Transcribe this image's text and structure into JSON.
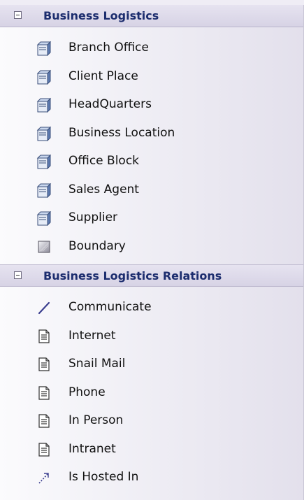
{
  "toolbox": {
    "groups": [
      {
        "title": "Business Logistics",
        "items": [
          {
            "label": "Branch Office",
            "icon": "node-icon"
          },
          {
            "label": "Client Place",
            "icon": "node-icon"
          },
          {
            "label": "HeadQuarters",
            "icon": "node-icon"
          },
          {
            "label": "Business Location",
            "icon": "node-icon"
          },
          {
            "label": "Office Block",
            "icon": "node-icon"
          },
          {
            "label": "Sales Agent",
            "icon": "node-icon"
          },
          {
            "label": "Supplier",
            "icon": "node-icon"
          },
          {
            "label": "Boundary",
            "icon": "boundary-icon"
          }
        ]
      },
      {
        "title": "Business Logistics Relations",
        "items": [
          {
            "label": "Communicate",
            "icon": "line-icon"
          },
          {
            "label": "Internet",
            "icon": "note-icon"
          },
          {
            "label": "Snail Mail",
            "icon": "note-icon"
          },
          {
            "label": "Phone",
            "icon": "note-icon"
          },
          {
            "label": "In Person",
            "icon": "note-icon"
          },
          {
            "label": "Intranet",
            "icon": "note-icon"
          },
          {
            "label": "Is Hosted In",
            "icon": "dashed-arrow-icon"
          }
        ]
      }
    ]
  }
}
